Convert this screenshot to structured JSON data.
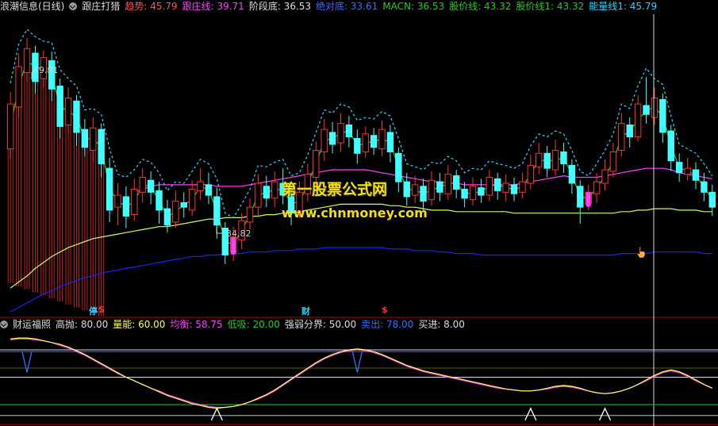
{
  "top_header": {
    "title": "浪潮信息(日线)",
    "indicator_name": "跟庄打猎",
    "items": [
      {
        "label": "趋势:",
        "value": "45.79",
        "color": "#ff5252"
      },
      {
        "label": "跟庄线:",
        "value": "39.71",
        "color": "#ff40ff"
      },
      {
        "label": "阶段底:",
        "value": "36.53",
        "color": "#dddddd"
      },
      {
        "label": "绝对底:",
        "value": "33.61",
        "color": "#3a6bff"
      },
      {
        "label": "MACN:",
        "value": "36.53",
        "color": "#22cc22"
      },
      {
        "label": "股价线:",
        "value": "43.32",
        "color": "#22cc22"
      },
      {
        "label": "股价线1:",
        "value": "43.32",
        "color": "#22cc22"
      },
      {
        "label": "能量线1:",
        "value": "45.79",
        "color": "#28d7ff"
      }
    ]
  },
  "sub_header": {
    "indicator_name": "财运福照",
    "items": [
      {
        "label": "高抛:",
        "value": "80.00",
        "color": "#dddddd"
      },
      {
        "label": "量能:",
        "value": "60.00",
        "color": "#ffff40"
      },
      {
        "label": "均衡:",
        "value": "58.75",
        "color": "#ff40ff"
      },
      {
        "label": "低吸:",
        "value": "20.00",
        "color": "#22cc22"
      },
      {
        "label": "强弱分界:",
        "value": "50.00",
        "color": "#dddddd"
      },
      {
        "label": "卖出:",
        "value": "78.00",
        "color": "#3a6bff"
      },
      {
        "label": "买进:",
        "value": "8.00",
        "color": "#dddddd"
      }
    ]
  },
  "annotations": {
    "high_price": "49.91",
    "low_price": "34.82"
  },
  "watermark": {
    "line1": "第一股票公式网",
    "line2": "www.chnmoney.com"
  },
  "markers": [
    {
      "text": "停",
      "color": "#28d7ff"
    },
    {
      "text": "S",
      "color": "#ff3030"
    },
    {
      "text": "财",
      "color": "#28d7ff"
    },
    {
      "text": "$",
      "color": "#ff3030"
    }
  ],
  "colors": {
    "background": "#000000",
    "up": "#ff3232",
    "down": "#40ffff",
    "yellow_ma": "#c8ff60",
    "blue_ma": "#2020ff",
    "magenta_ma": "#ff40ff",
    "divider": "#b00000"
  },
  "chart_data": {
    "type": "candlestick",
    "candles": [
      [
        42.5,
        45.5,
        41.9,
        46.3
      ],
      [
        45.3,
        48.0,
        44.6,
        48.9
      ],
      [
        47.6,
        49.2,
        46.9,
        49.9
      ],
      [
        48.9,
        47.0,
        46.2,
        49.4
      ],
      [
        47.2,
        48.6,
        46.6,
        49.1
      ],
      [
        48.4,
        46.5,
        45.7,
        49.0
      ],
      [
        46.7,
        44.0,
        43.2,
        47.2
      ],
      [
        44.1,
        45.9,
        43.5,
        46.6
      ],
      [
        45.7,
        43.6,
        42.7,
        46.1
      ],
      [
        43.8,
        42.6,
        42.0,
        44.5
      ],
      [
        42.4,
        43.9,
        41.6,
        44.6
      ],
      [
        43.8,
        41.5,
        40.6,
        44.2
      ],
      [
        41.2,
        38.4,
        37.6,
        41.9
      ],
      [
        38.6,
        39.4,
        37.4,
        40.2
      ],
      [
        39.3,
        38.0,
        37.2,
        40.0
      ],
      [
        38.1,
        39.8,
        37.7,
        40.5
      ],
      [
        39.6,
        40.6,
        38.9,
        41.2
      ],
      [
        40.4,
        39.6,
        38.8,
        41.0
      ],
      [
        39.7,
        38.4,
        37.5,
        40.3
      ],
      [
        38.5,
        37.4,
        36.9,
        39.1
      ],
      [
        37.6,
        39.0,
        37.2,
        39.7
      ],
      [
        38.9,
        38.6,
        37.9,
        39.6
      ],
      [
        38.4,
        39.8,
        38.0,
        40.4
      ],
      [
        39.7,
        40.3,
        39.1,
        41.2
      ],
      [
        40.1,
        39.4,
        38.8,
        40.9
      ],
      [
        39.3,
        37.4,
        36.5,
        39.9
      ],
      [
        37.2,
        35.4,
        34.8,
        37.6
      ],
      [
        35.6,
        36.6,
        35.0,
        37.3
      ],
      [
        36.4,
        37.7,
        35.8,
        38.2
      ],
      [
        37.6,
        38.6,
        37.1,
        39.2
      ],
      [
        38.6,
        40.2,
        37.9,
        40.8
      ],
      [
        40.0,
        39.2,
        38.6,
        40.7
      ],
      [
        39.2,
        40.3,
        38.6,
        41.0
      ],
      [
        40.2,
        39.4,
        38.8,
        41.2
      ],
      [
        39.5,
        38.2,
        37.4,
        40.1
      ],
      [
        38.3,
        39.6,
        37.9,
        40.3
      ],
      [
        39.5,
        40.8,
        39.0,
        41.5
      ],
      [
        40.6,
        42.4,
        40.1,
        43.0
      ],
      [
        42.3,
        43.8,
        41.7,
        44.5
      ],
      [
        43.6,
        42.8,
        42.2,
        44.3
      ],
      [
        42.9,
        44.2,
        42.3,
        44.9
      ],
      [
        44.1,
        43.3,
        42.6,
        44.7
      ],
      [
        43.2,
        42.2,
        41.5,
        43.8
      ],
      [
        42.3,
        43.5,
        41.9,
        44.0
      ],
      [
        43.4,
        42.6,
        42.1,
        43.9
      ],
      [
        42.5,
        43.8,
        42.0,
        44.4
      ],
      [
        43.6,
        42.3,
        41.6,
        44.1
      ],
      [
        42.2,
        40.3,
        39.6,
        42.6
      ],
      [
        40.3,
        39.3,
        38.7,
        40.9
      ],
      [
        39.4,
        40.1,
        38.9,
        40.7
      ],
      [
        40.0,
        39.0,
        38.4,
        40.5
      ],
      [
        39.1,
        40.4,
        38.7,
        41.0
      ],
      [
        40.3,
        39.6,
        39.0,
        40.9
      ],
      [
        39.5,
        40.8,
        39.1,
        41.4
      ],
      [
        40.7,
        39.8,
        39.2,
        41.1
      ],
      [
        39.8,
        39.2,
        38.6,
        40.3
      ],
      [
        39.1,
        40.0,
        38.7,
        40.6
      ],
      [
        39.9,
        39.4,
        38.9,
        40.5
      ],
      [
        39.4,
        40.6,
        39.0,
        41.1
      ],
      [
        40.5,
        39.7,
        39.1,
        40.9
      ],
      [
        39.6,
        40.2,
        39.0,
        40.8
      ],
      [
        40.1,
        39.5,
        39.0,
        40.6
      ],
      [
        39.6,
        40.3,
        39.2,
        40.9
      ],
      [
        40.2,
        41.4,
        39.8,
        42.1
      ],
      [
        41.3,
        42.2,
        40.8,
        42.9
      ],
      [
        42.2,
        41.2,
        40.6,
        42.7
      ],
      [
        41.1,
        42.4,
        40.7,
        43.1
      ],
      [
        42.3,
        41.5,
        40.9,
        42.9
      ],
      [
        41.4,
        40.2,
        39.5,
        41.8
      ],
      [
        40.0,
        38.6,
        37.5,
        40.4
      ],
      [
        38.8,
        39.6,
        38.4,
        40.1
      ],
      [
        39.5,
        40.3,
        38.9,
        40.9
      ],
      [
        40.2,
        41.1,
        39.7,
        41.8
      ],
      [
        41.0,
        42.3,
        40.6,
        42.9
      ],
      [
        42.4,
        44.2,
        42.0,
        44.9
      ],
      [
        44.1,
        43.3,
        42.6,
        44.6
      ],
      [
        43.3,
        45.5,
        43.0,
        46.1
      ],
      [
        45.4,
        44.8,
        44.2,
        47.3
      ],
      [
        44.6,
        45.9,
        44.1,
        46.6
      ],
      [
        45.8,
        43.6,
        42.9,
        46.2
      ],
      [
        43.7,
        41.7,
        41.0,
        44.1
      ],
      [
        41.6,
        40.9,
        40.3,
        42.2
      ],
      [
        40.8,
        41.2,
        40.4,
        41.9
      ],
      [
        41.1,
        40.4,
        39.8,
        41.6
      ],
      [
        40.3,
        39.6,
        39.0,
        40.9
      ],
      [
        39.6,
        38.6,
        38.0,
        40.1
      ]
    ],
    "price_range": [
      31.5,
      51.5
    ],
    "ma_yellow": [
      33.2,
      33.6,
      34.0,
      34.5,
      34.9,
      35.3,
      35.6,
      35.9,
      36.1,
      36.3,
      36.5,
      36.6,
      36.7,
      36.8,
      36.9,
      37.0,
      37.1,
      37.2,
      37.3,
      37.3,
      37.4,
      37.5,
      37.6,
      37.7,
      37.8,
      37.8,
      37.9,
      37.9,
      37.9,
      38.0,
      38.0,
      38.1,
      38.1,
      38.2,
      38.2,
      38.3,
      38.4,
      38.5,
      38.6,
      38.7,
      38.8,
      38.8,
      38.8,
      38.8,
      38.8,
      38.8,
      38.7,
      38.7,
      38.6,
      38.6,
      38.5,
      38.4,
      38.4,
      38.4,
      38.3,
      38.3,
      38.3,
      38.3,
      38.3,
      38.3,
      38.3,
      38.2,
      38.2,
      38.2,
      38.2,
      38.2,
      38.2,
      38.2,
      38.2,
      38.2,
      38.2,
      38.2,
      38.2,
      38.2,
      38.3,
      38.3,
      38.4,
      38.4,
      38.5,
      38.5,
      38.5,
      38.4,
      38.4,
      38.4,
      38.3,
      38.3
    ],
    "ma_blue": [
      31.6,
      31.9,
      32.2,
      32.5,
      32.8,
      33.0,
      33.3,
      33.5,
      33.7,
      33.9,
      34.0,
      34.2,
      34.3,
      34.4,
      34.5,
      34.6,
      34.7,
      34.8,
      34.9,
      35.0,
      35.1,
      35.2,
      35.3,
      35.3,
      35.4,
      35.4,
      35.5,
      35.5,
      35.5,
      35.6,
      35.6,
      35.6,
      35.7,
      35.7,
      35.7,
      35.8,
      35.8,
      35.8,
      35.9,
      35.9,
      35.9,
      35.9,
      35.9,
      35.9,
      35.9,
      35.9,
      35.8,
      35.8,
      35.8,
      35.7,
      35.7,
      35.7,
      35.6,
      35.6,
      35.5,
      35.5,
      35.5,
      35.4,
      35.4,
      35.4,
      35.4,
      35.4,
      35.4,
      35.4,
      35.4,
      35.4,
      35.4,
      35.4,
      35.4,
      35.4,
      35.4,
      35.4,
      35.4,
      35.4,
      35.5,
      35.5,
      35.5,
      35.5,
      35.6,
      35.6,
      35.6,
      35.6,
      35.6,
      35.6,
      35.5,
      35.5
    ],
    "ma_magenta": [
      null,
      null,
      null,
      null,
      null,
      null,
      null,
      null,
      null,
      null,
      null,
      null,
      null,
      null,
      null,
      39.6,
      39.8,
      40.0,
      40.1,
      40.1,
      40.1,
      40.1,
      40.1,
      40.1,
      40.1,
      40.0,
      40.0,
      40.0,
      40.0,
      40.1,
      40.2,
      40.3,
      40.4,
      40.5,
      40.6,
      40.7,
      40.8,
      40.9,
      41.0,
      41.1,
      41.1,
      41.1,
      41.1,
      41.1,
      41.0,
      40.9,
      40.8,
      40.7,
      40.6,
      40.5,
      40.4,
      40.3,
      40.3,
      40.2,
      40.2,
      40.1,
      40.1,
      40.1,
      40.1,
      40.1,
      40.1,
      40.1,
      40.2,
      40.3,
      40.4,
      40.5,
      40.6,
      40.7,
      40.6,
      40.6,
      40.6,
      40.6,
      40.7,
      40.8,
      40.9,
      41.0,
      41.1,
      41.2,
      41.2,
      41.2,
      41.1,
      40.9,
      40.8,
      40.7,
      40.6,
      40.5
    ],
    "osc_range": [
      0,
      100
    ],
    "osc_levels": {
      "high_sell": 80,
      "volume": 60,
      "balance": 58.75,
      "low_buy": 20,
      "divide": 50,
      "sell": 78,
      "buy": 8
    },
    "osc_yellow": [
      92,
      93,
      93,
      92,
      90,
      88,
      86,
      83,
      79,
      75,
      70,
      65,
      60,
      55,
      50,
      46,
      42,
      38,
      34,
      30,
      27,
      24,
      21,
      19,
      17,
      16,
      17,
      18,
      20,
      23,
      27,
      31,
      36,
      42,
      48,
      54,
      60,
      66,
      71,
      75,
      78,
      80,
      81,
      80,
      78,
      75,
      71,
      67,
      63,
      60,
      57,
      55,
      53,
      51,
      49,
      47,
      45,
      43,
      41,
      39,
      37,
      36,
      35,
      35,
      36,
      38,
      40,
      41,
      40,
      38,
      35,
      33,
      32,
      33,
      35,
      38,
      42,
      47,
      52,
      56,
      58,
      56,
      52,
      47,
      42,
      38
    ],
    "osc_magenta": [
      91,
      92,
      92,
      91,
      90,
      88,
      85,
      82,
      78,
      74,
      69,
      64,
      59,
      54,
      50,
      46,
      42,
      38,
      35,
      31,
      28,
      25,
      22,
      20,
      18,
      17,
      17,
      18,
      20,
      23,
      26,
      30,
      35,
      41,
      47,
      53,
      59,
      65,
      70,
      74,
      77,
      79,
      80,
      79,
      77,
      74,
      70,
      66,
      62,
      59,
      56,
      54,
      52,
      50,
      48,
      46,
      44,
      42,
      40,
      38,
      37,
      36,
      35,
      35,
      36,
      37,
      39,
      40,
      39,
      37,
      35,
      33,
      32,
      33,
      35,
      38,
      42,
      46,
      51,
      55,
      57,
      55,
      51,
      46,
      42,
      38
    ]
  }
}
